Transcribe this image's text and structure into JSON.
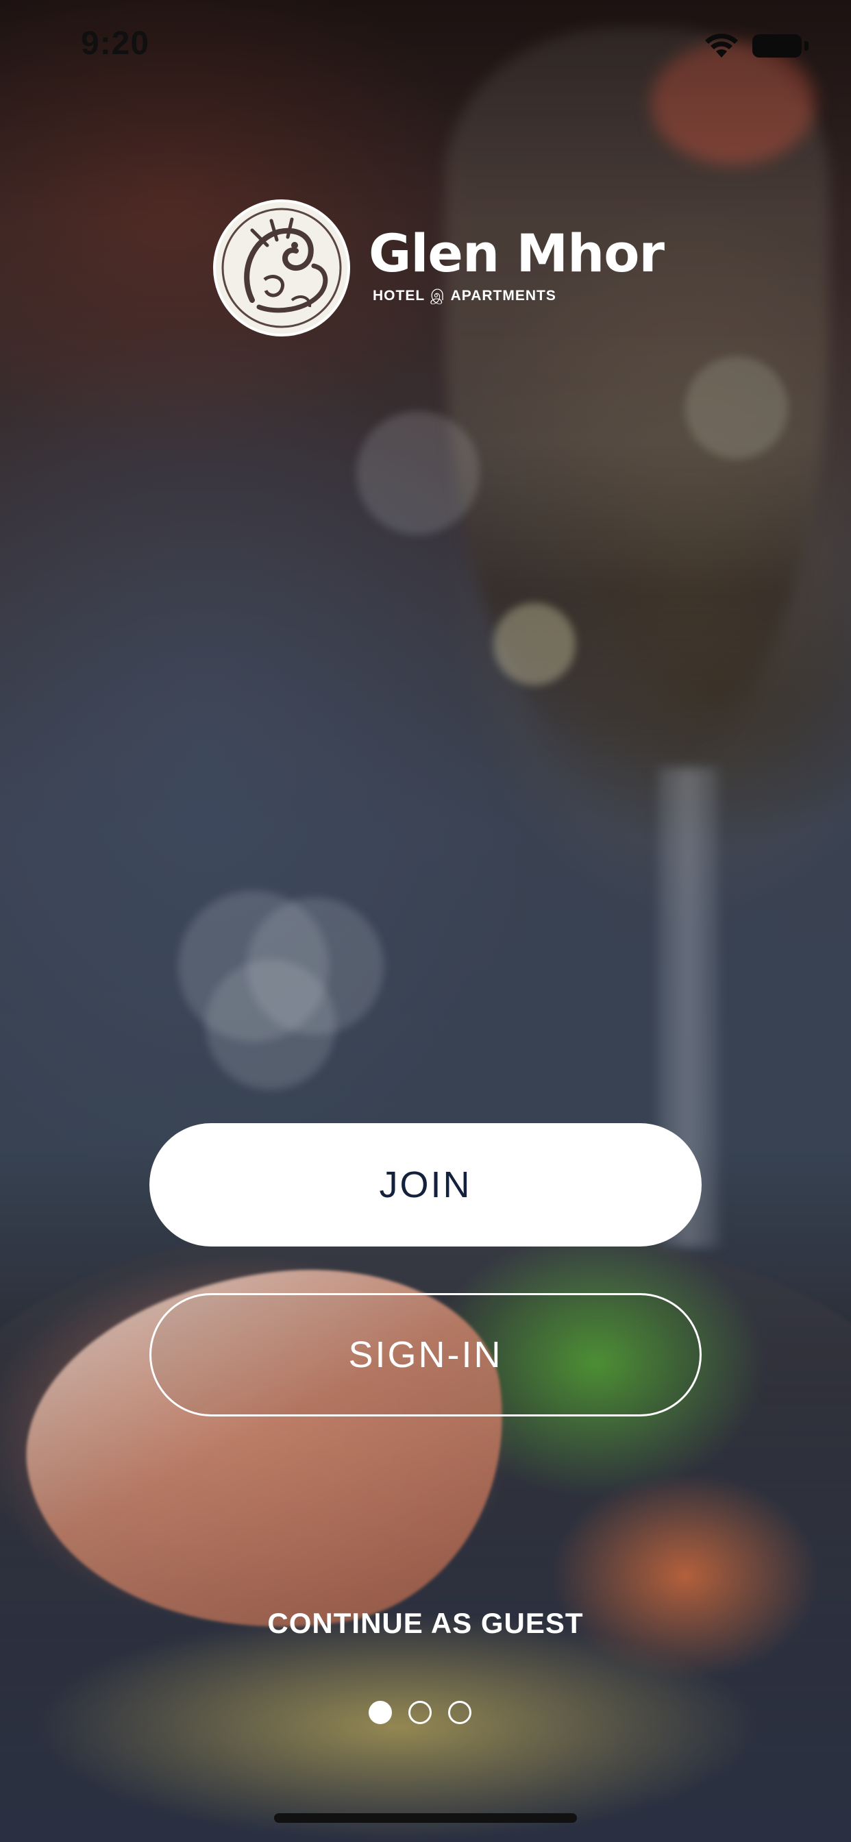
{
  "status_bar": {
    "time": "9:20",
    "wifi_icon": "wifi-icon",
    "battery_icon": "battery-full-icon"
  },
  "brand": {
    "emblem_icon": "dragon-emblem-icon",
    "name": "Glen Mhor",
    "tagline_left": "HOTEL",
    "tagline_separator": "இ",
    "tagline_right": "APARTMENTS"
  },
  "actions": {
    "join_label": "JOIN",
    "signin_label": "SIGN-IN",
    "guest_label": "CONTINUE AS GUEST"
  },
  "pager": {
    "page_count": 3,
    "active_index": 0
  },
  "colors": {
    "join_text": "#14213d",
    "button_fill": "#ffffff",
    "outline": "#ffffff"
  }
}
